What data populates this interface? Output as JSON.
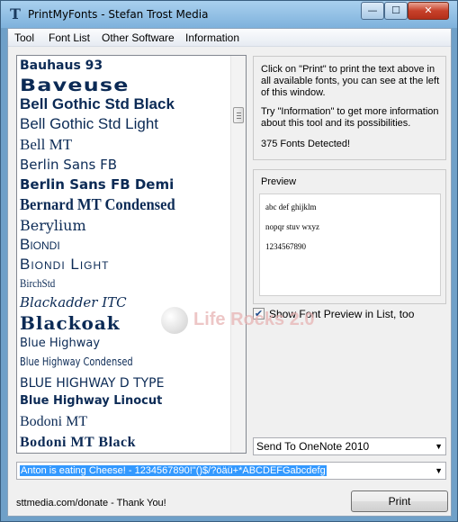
{
  "window": {
    "title": "PrintMyFonts - Stefan Trost Media",
    "icon_glyph": "T",
    "minimize_glyph": "—",
    "maximize_glyph": "☐",
    "close_glyph": "✕"
  },
  "menu": {
    "items": [
      "Tool",
      "Font List",
      "Other Software",
      "Information"
    ]
  },
  "font_list": {
    "items": [
      "Bauhaus 93",
      "Baveuse",
      "Bell Gothic Std Black",
      "Bell Gothic Std Light",
      "Bell MT",
      "Berlin Sans FB",
      "Berlin Sans FB Demi",
      "Bernard MT Condensed",
      "Berylium",
      "Biondi",
      "Biondi Light",
      "BirchStd",
      "Blackadder ITC",
      "Blackoak",
      "Blue Highway",
      "Blue Highway Condensed",
      "BLUE HIGHWAY D TYPE",
      "Blue Highway Linocut",
      "Bodoni MT",
      "Bodoni MT Black"
    ]
  },
  "info": {
    "paragraph1": "Click on \"Print\" to print the text above in all available fonts, you can see at the left of this window.",
    "paragraph2": "Try \"Information\" to get more information about this tool and its possibilities.",
    "fonts_detected": "375 Fonts Detected!"
  },
  "preview": {
    "label": "Preview",
    "lines": [
      "abc def ghijklm",
      "nopqr stuv wxyz",
      "1234567890"
    ]
  },
  "checkbox": {
    "label": "Show Font Preview in List, too",
    "checked": true,
    "check_glyph": "✔"
  },
  "watermark": {
    "text": "Life Rocks 2.0"
  },
  "printer_select": {
    "value": "Send To OneNote 2010",
    "arrow_glyph": "▼"
  },
  "sample_text": {
    "value": "Anton is eating Cheese! - 1234567890!\"()$/?öäü+*ABCDEFGabcdefg",
    "arrow_glyph": "▼"
  },
  "footer": {
    "donate_text": "sttmedia.com/donate - Thank You!",
    "print_label": "Print"
  }
}
